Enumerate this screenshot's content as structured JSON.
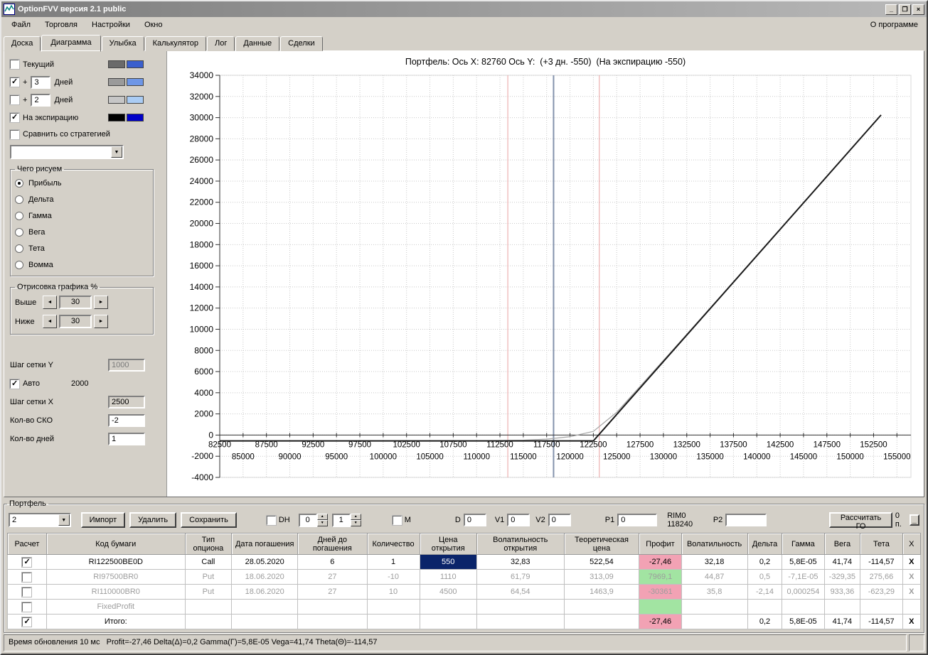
{
  "icons": {
    "dropdown_arrow": "▼",
    "spin_up": "▲",
    "spin_down": "▼",
    "left_arrow": "◄",
    "right_arrow": "►",
    "minimize": "_",
    "maximize": "❐",
    "close": "×"
  },
  "window": {
    "title": "OptionFVV версия 2.1 public"
  },
  "menu": {
    "items": [
      {
        "key": "file",
        "label": "Файл"
      },
      {
        "key": "trading",
        "label": "Торговля"
      },
      {
        "key": "settings",
        "label": "Настройки"
      },
      {
        "key": "window",
        "label": "Окно"
      }
    ],
    "about": "О программе"
  },
  "tabs": [
    {
      "key": "board",
      "label": "Доска",
      "active": false
    },
    {
      "key": "diagram",
      "label": "Диаграмма",
      "active": true
    },
    {
      "key": "smile",
      "label": "Улыбка",
      "active": false
    },
    {
      "key": "calculator",
      "label": "Калькулятор",
      "active": false
    },
    {
      "key": "log",
      "label": "Лог",
      "active": false
    },
    {
      "key": "data",
      "label": "Данные",
      "active": false
    },
    {
      "key": "deals",
      "label": "Сделки",
      "active": false
    }
  ],
  "left_panel": {
    "lines": [
      {
        "key": "current",
        "label": "Текущий",
        "checked": false,
        "swatch1": "#6a6a6a",
        "swatch2": "#3a5fcd"
      },
      {
        "key": "plus3",
        "prefix": "+",
        "value": "3",
        "label": "Дней",
        "checked": true,
        "swatch1": "#9a9a9a",
        "swatch2": "#6e96e6"
      },
      {
        "key": "plus2",
        "prefix": "+",
        "value": "2",
        "label": "Дней",
        "checked": false,
        "swatch1": "#c6c6c6",
        "swatch2": "#aaccf4"
      },
      {
        "key": "expiration",
        "label": "На экспирацию",
        "checked": true,
        "swatch1": "#000000",
        "swatch2": "#0000c8"
      }
    ],
    "compare_label": "Сравнить со стратегией",
    "compare_checked": false,
    "strategy_value": "",
    "what_draw": {
      "title": "Чего рисуем",
      "options": [
        {
          "key": "profit",
          "label": "Прибыль",
          "selected": true
        },
        {
          "key": "delta",
          "label": "Дельта",
          "selected": false
        },
        {
          "key": "gamma",
          "label": "Гамма",
          "selected": false
        },
        {
          "key": "vega",
          "label": "Вега",
          "selected": false
        },
        {
          "key": "theta",
          "label": "Тета",
          "selected": false
        },
        {
          "key": "vomma",
          "label": "Вомма",
          "selected": false
        }
      ]
    },
    "render_pct": {
      "title": "Отрисовка графика %",
      "rows": [
        {
          "key": "above",
          "label": "Выше",
          "value": "30"
        },
        {
          "key": "below",
          "label": "Ниже",
          "value": "30"
        }
      ]
    },
    "grid_y_label": "Шаг сетки Y",
    "grid_y_value": "1000",
    "auto_label": "Авто",
    "auto_checked": true,
    "auto_value": "2000",
    "grid_x_label": "Шаг сетки X",
    "grid_x_value": "2500",
    "cko_label": "Кол-во СКО",
    "cko_value": "-2",
    "days_label": "Кол-во дней",
    "days_value": "1"
  },
  "chart_data": {
    "type": "line",
    "title": "Портфель: Ось X: 82760 Ось Y:  (+3 дн. -550)  (На экспирацию -550)",
    "xlim": [
      82500,
      156500
    ],
    "ylim": [
      -4000,
      34000
    ],
    "x_tick_step": 2500,
    "x_tick_max": 155000,
    "y_tick_step": 2000,
    "grid": true,
    "legend_position": "none",
    "vlines": [
      {
        "x": 118240,
        "color": "#8493ad",
        "width": 2,
        "name": "current-price-line"
      },
      {
        "x": 113340,
        "color": "#e9a2a2",
        "width": 1,
        "name": "sigma-line-left"
      },
      {
        "x": 123140,
        "color": "#e9a2a2",
        "width": 1,
        "name": "sigma-line-right"
      }
    ],
    "series": [
      {
        "name": "+3 дн.",
        "color": "#a8a8a8",
        "width": 1.3,
        "points": [
          [
            82500,
            -550
          ],
          [
            100000,
            -550
          ],
          [
            105000,
            -549
          ],
          [
            107500,
            -548
          ],
          [
            110000,
            -542
          ],
          [
            112500,
            -525
          ],
          [
            115000,
            -480
          ],
          [
            117500,
            -380
          ],
          [
            120000,
            -150
          ],
          [
            122500,
            350
          ],
          [
            125000,
            2150
          ],
          [
            127500,
            4600
          ],
          [
            130000,
            7050
          ],
          [
            132500,
            9520
          ],
          [
            135000,
            12000
          ],
          [
            137500,
            14480
          ],
          [
            140000,
            16970
          ],
          [
            142500,
            19460
          ],
          [
            145000,
            21960
          ],
          [
            147500,
            24455
          ],
          [
            150000,
            26955
          ],
          [
            153300,
            30260
          ]
        ]
      },
      {
        "name": "На экспирацию",
        "color": "#1a1a1a",
        "width": 2,
        "points": [
          [
            82500,
            -550
          ],
          [
            122500,
            -550
          ],
          [
            153300,
            30250
          ]
        ]
      }
    ]
  },
  "portfolio": {
    "group_title": "Портфель",
    "selector_value": "2",
    "buttons": {
      "import": "Импорт",
      "delete": "Удалить",
      "save": "Сохранить",
      "calc_go": "Рассчитать ГО"
    },
    "dh_label": "DH",
    "dh_checked": false,
    "spin1": "0",
    "spin2": "1",
    "m_label": "M",
    "m_checked": false,
    "d_label": "D",
    "d_value": "0",
    "v1_label": "V1",
    "v1_value": "0",
    "v2_label": "V2",
    "v2_value": "0",
    "p1_label": "P1",
    "p1_value": "0",
    "rim_label": "RIM0 118240",
    "p2_label": "P2",
    "p2_value": "",
    "points_label": "0 п.",
    "profit_colors": {
      "pink": "#f2a2b4",
      "green": "#a2e4a2"
    },
    "table": {
      "headers": [
        {
          "key": "calc",
          "label": "Расчет"
        },
        {
          "key": "code",
          "label": "Код бумаги"
        },
        {
          "key": "type",
          "label": "Тип опциона"
        },
        {
          "key": "date",
          "label": "Дата погашения"
        },
        {
          "key": "days",
          "label": "Дней до погашения"
        },
        {
          "key": "qty",
          "label": "Количество"
        },
        {
          "key": "open_price",
          "label": "Цена открытия"
        },
        {
          "key": "open_vol",
          "label": "Волатильность открытия"
        },
        {
          "key": "theo",
          "label": "Теоретическая цена"
        },
        {
          "key": "profit",
          "label": "Профит"
        },
        {
          "key": "vol",
          "label": "Волатильность"
        },
        {
          "key": "delta",
          "label": "Дельта"
        },
        {
          "key": "gamma",
          "label": "Гамма"
        },
        {
          "key": "vega",
          "label": "Вега"
        },
        {
          "key": "theta",
          "label": "Тета"
        },
        {
          "key": "close",
          "label": "X"
        }
      ],
      "rows": [
        {
          "checked": true,
          "enabled": true,
          "code": "RI122500BE0D",
          "type": "Call",
          "date": "28.05.2020",
          "days": "6",
          "qty": "1",
          "open_price": "550",
          "open_price_selected": true,
          "open_vol": "32,83",
          "theo": "522,54",
          "profit": "-27,46",
          "profit_bg": "pink",
          "vol": "32,18",
          "delta": "0,2",
          "gamma": "5,8E-05",
          "vega": "41,74",
          "theta": "-114,57",
          "close": "X"
        },
        {
          "checked": false,
          "enabled": false,
          "code": "RI97500BR0",
          "type": "Put",
          "date": "18.06.2020",
          "days": "27",
          "qty": "-10",
          "open_price": "1110",
          "open_price_selected": false,
          "open_vol": "61,79",
          "theo": "313,09",
          "profit": "7969,1",
          "profit_bg": "green",
          "vol": "44,87",
          "delta": "0,5",
          "gamma": "-7,1E-05",
          "vega": "-329,35",
          "theta": "275,66",
          "close": "X"
        },
        {
          "checked": false,
          "enabled": false,
          "code": "RI110000BR0",
          "type": "Put",
          "date": "18.06.2020",
          "days": "27",
          "qty": "10",
          "open_price": "4500",
          "open_price_selected": false,
          "open_vol": "64,54",
          "theo": "1463,9",
          "profit": "-30361",
          "profit_bg": "pink",
          "vol": "35,8",
          "delta": "-2,14",
          "gamma": "0,000254",
          "vega": "933,36",
          "theta": "-623,29",
          "close": "X"
        },
        {
          "checked": false,
          "enabled": false,
          "code": "FixedProfit",
          "type": "",
          "date": "",
          "days": "",
          "qty": "",
          "open_price": "",
          "open_price_selected": false,
          "open_vol": "",
          "theo": "",
          "profit": "",
          "profit_bg": "green",
          "vol": "",
          "delta": "",
          "gamma": "",
          "vega": "",
          "theta": "",
          "close": ""
        },
        {
          "checked": true,
          "enabled": true,
          "code": "Итого:",
          "type": "",
          "date": "",
          "days": "",
          "qty": "",
          "open_price": "",
          "open_price_selected": false,
          "open_vol": "",
          "theo": "",
          "profit": "-27,46",
          "profit_bg": "pink",
          "vol": "",
          "delta": "0,2",
          "gamma": "5,8E-05",
          "vega": "41,74",
          "theta": "-114,57",
          "close": "X"
        }
      ]
    }
  },
  "statusbar": {
    "text": "Время обновления 10 мс   Profit=-27,46 Delta(Δ)=0,2 Gamma(Γ)=5,8E-05 Vega=41,74 Theta(Θ)=-114,57"
  }
}
